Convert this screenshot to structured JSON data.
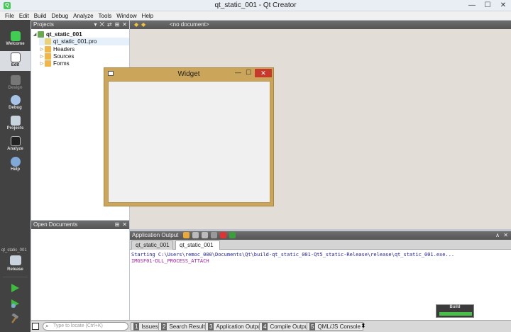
{
  "window": {
    "title": "qt_static_001 - Qt Creator",
    "controls": [
      "—",
      "☐",
      "✕"
    ]
  },
  "menu": [
    "File",
    "Edit",
    "Build",
    "Debug",
    "Analyze",
    "Tools",
    "Window",
    "Help"
  ],
  "modes": [
    {
      "label": "Welcome",
      "icon": "qt-logo-icon"
    },
    {
      "label": "Edit",
      "icon": "edit-icon"
    },
    {
      "label": "Design",
      "icon": "design-icon"
    },
    {
      "label": "Debug",
      "icon": "debug-icon"
    },
    {
      "label": "Projects",
      "icon": "projects-icon"
    },
    {
      "label": "Analyze",
      "icon": "analyze-icon"
    },
    {
      "label": "Help",
      "icon": "help-icon"
    }
  ],
  "kit": {
    "label": "qt_static_001",
    "config": "Release"
  },
  "projects_panel": {
    "title": "Projects",
    "tools": [
      "▾",
      "⨉",
      "⇄",
      "⊞",
      "✕"
    ],
    "tree": [
      {
        "label": "qt_static_001",
        "depth": 0,
        "arrow": "◢",
        "icon_color": "#6aa84f"
      },
      {
        "label": "qt_static_001.pro",
        "depth": 1,
        "arrow": "",
        "icon_color": "#e8d27a"
      },
      {
        "label": "Headers",
        "depth": 1,
        "arrow": "▷",
        "icon_color": "#f0b64a"
      },
      {
        "label": "Sources",
        "depth": 1,
        "arrow": "▷",
        "icon_color": "#f0b64a"
      },
      {
        "label": "Forms",
        "depth": 1,
        "arrow": "▷",
        "icon_color": "#f0b64a"
      }
    ]
  },
  "editor": {
    "document": "<no document>",
    "nav": [
      "◆",
      "◆"
    ]
  },
  "open_documents": {
    "title": "Open Documents",
    "tools": [
      "⊞",
      "✕"
    ]
  },
  "widget_window": {
    "title": "Widget",
    "min": "—",
    "max": "☐",
    "close": "✕"
  },
  "app_output": {
    "title": "Application Output",
    "tabs": [
      {
        "label": "qt_static_001",
        "close": "✕"
      },
      {
        "label": "qt_static_001",
        "close": "✕"
      }
    ],
    "lines": [
      "Starting C:\\Users\\remoc_000\\Documents\\Qt\\build-qt_static_001-Qt5_static-Release\\release\\qt_static_001.exe...",
      "IMGSF01-DLL_PROCESS_ATTACH"
    ],
    "right_tools": [
      "∧",
      "✕"
    ]
  },
  "statusbar": {
    "locator_placeholder": "Type to locate (Ctrl+K)",
    "tabs": [
      {
        "num": "1",
        "label": "Issues"
      },
      {
        "num": "2",
        "label": "Search Results"
      },
      {
        "num": "3",
        "label": "Application Output"
      },
      {
        "num": "4",
        "label": "Compile Output"
      },
      {
        "num": "5",
        "label": "QML/JS Console"
      }
    ],
    "more": "⬍"
  },
  "build": {
    "label": "Build",
    "progress": 1.0
  },
  "colors": {
    "accent": "#41cd52",
    "widget_frame": "#cba55a",
    "close_red": "#c7392a",
    "output_blue": "#2020a8",
    "output_purple": "#a020a0"
  }
}
